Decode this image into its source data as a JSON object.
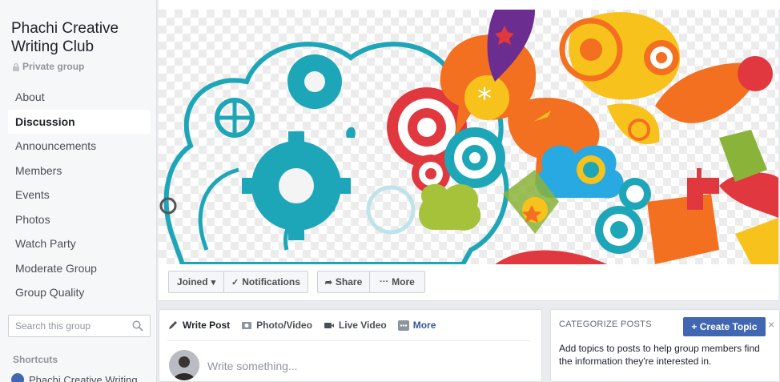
{
  "group": {
    "name": "Phachi Creative Writing Club",
    "privacy": "Private group"
  },
  "nav": {
    "items": [
      {
        "label": "About"
      },
      {
        "label": "Discussion"
      },
      {
        "label": "Announcements"
      },
      {
        "label": "Members"
      },
      {
        "label": "Events"
      },
      {
        "label": "Photos"
      },
      {
        "label": "Watch Party"
      },
      {
        "label": "Moderate Group"
      },
      {
        "label": "Group Quality"
      }
    ],
    "active": "Discussion"
  },
  "search": {
    "placeholder": "Search this group"
  },
  "shortcuts": {
    "title": "Shortcuts",
    "items": [
      {
        "label": "Phachi Creative Writing"
      }
    ]
  },
  "actions": {
    "joined": "Joined",
    "notifications": "Notifications",
    "share": "Share",
    "more": "More"
  },
  "composer": {
    "tabs": {
      "write_post": "Write Post",
      "photo_video": "Photo/Video",
      "live_video": "Live Video",
      "more": "More"
    },
    "placeholder": "Write something..."
  },
  "categorize": {
    "title": "CATEGORIZE POSTS",
    "create_topic": "+ Create Topic",
    "close": "×",
    "description": "Add topics to posts to help group members find the information they're interested in."
  },
  "colors": {
    "brand_blue": "#4267b2",
    "link_blue": "#365899",
    "background": "#e9ebee",
    "teal": "#1da6b8",
    "orange": "#f37021",
    "yellow": "#f8c21c",
    "red": "#e0383e",
    "purple": "#6b2d8f"
  },
  "icons": [
    "lock-icon",
    "search-icon",
    "chevron-down-icon",
    "check-icon",
    "share-arrow-icon",
    "ellipsis-icon",
    "pencil-icon",
    "photo-icon",
    "video-icon",
    "grid-icon",
    "close-icon"
  ]
}
